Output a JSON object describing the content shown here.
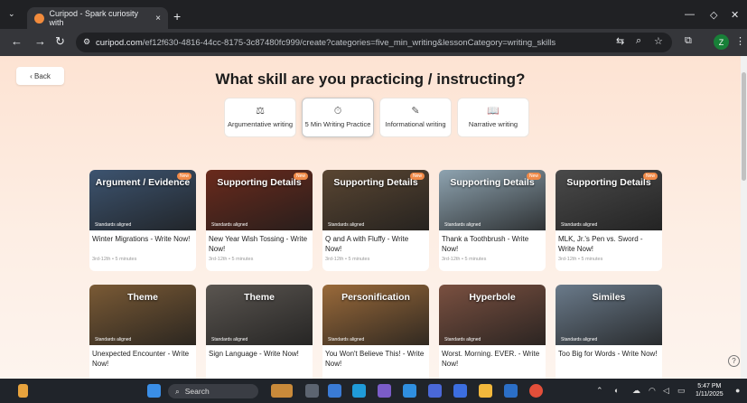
{
  "browser": {
    "tab_title": "Curipod - Spark curiosity with",
    "tab_close": "×",
    "new_tab": "+",
    "url_host": "curipod.com",
    "url_path": "/ef12f630-4816-44cc-8175-3c87480fc999/create?categories=five_min_writing&lessonCategory=writing_skills",
    "profile_initial": "Z"
  },
  "page": {
    "back_label": "‹ Back",
    "title": "What skill are you practicing / instructing?",
    "skills": [
      {
        "label": "Argumentative writing",
        "icon": "⚖"
      },
      {
        "label": "5 Min Writing Practice",
        "icon": "⏱",
        "selected": true
      },
      {
        "label": "Informational writing",
        "icon": "✎"
      },
      {
        "label": "Narrative writing",
        "icon": "📖"
      }
    ],
    "standards_label": "Standards aligned",
    "new_badge": "New",
    "cards": [
      {
        "category": "Argument / Evidence",
        "title": "Winter Migrations - Write Now!",
        "grade": "3rd-12th",
        "duration": "5 minutes",
        "bg": "#3d5470"
      },
      {
        "category": "Supporting Details",
        "title": "New Year Wish Tossing - Write Now!",
        "grade": "3rd-12th",
        "duration": "5 minutes",
        "bg": "#6a2a1c"
      },
      {
        "category": "Supporting Details",
        "title": "Q and A with Fluffy - Write Now!",
        "grade": "3rd-12th",
        "duration": "5 minutes",
        "bg": "#5a4632"
      },
      {
        "category": "Supporting Details",
        "title": "Thank a Toothbrush - Write Now!",
        "grade": "3rd-12th",
        "duration": "5 minutes",
        "bg": "#8ea3b0"
      },
      {
        "category": "Supporting Details",
        "title": "MLK, Jr.'s Pen vs. Sword - Write Now!",
        "grade": "3rd-12th",
        "duration": "5 minutes",
        "bg": "#4a4a4a"
      },
      {
        "category": "Theme",
        "title": "Unexpected Encounter - Write Now!",
        "bg": "#7a5a35"
      },
      {
        "category": "Theme",
        "title": "Sign Language - Write Now!",
        "bg": "#5a5550"
      },
      {
        "category": "Personification",
        "title": "You Won't Believe This! - Write Now!",
        "bg": "#9a6a3a"
      },
      {
        "category": "Hyperbole",
        "title": "Worst. Morning. EVER. - Write Now!",
        "bg": "#7a5040"
      },
      {
        "category": "Similes",
        "title": "Too Big for Words - Write Now!",
        "bg": "#6a7a8a"
      }
    ],
    "help": "?"
  },
  "taskbar": {
    "search_label": "Search",
    "time": "5:47 PM",
    "date": "1/11/2025"
  }
}
